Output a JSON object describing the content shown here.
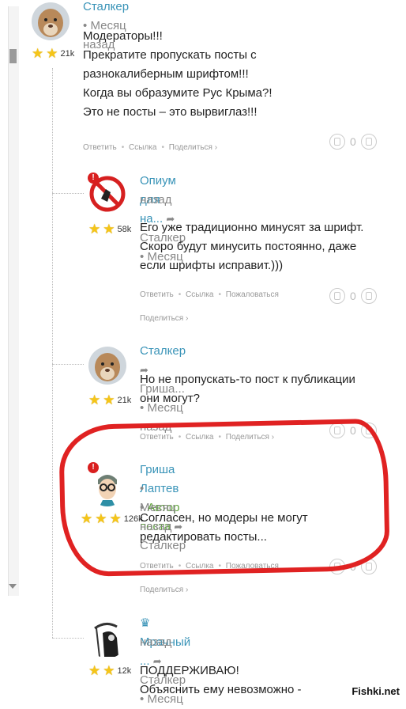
{
  "comments": [
    {
      "author": "Сталкер",
      "sep": "•",
      "time": "Месяц назад",
      "rank": "21k",
      "lines": [
        "Модераторы!!!",
        "Прекратите пропускать посты с",
        "разнокалиберным шрифтом!!!",
        "Когда вы образумите Рус Крыма?!",
        "Это не посты – это вырвиглаз!!!"
      ],
      "actions": [
        "Ответить",
        "Ссылка",
        "Поделиться ›"
      ],
      "score": "0"
    },
    {
      "author": "Опиум для на...",
      "reply_to": "Сталкер",
      "sep": "•",
      "time_line1": "Месяц",
      "time_line2": "назад",
      "rank": "58k",
      "lines": [
        "Его уже традиционно минусят за шрифт.",
        "Скоро будут минусить постоянно, даже",
        "если шрифты исправит.)))"
      ],
      "actions": [
        "Ответить",
        "Ссылка",
        "Пожаловаться"
      ],
      "actions2": "Поделиться ›",
      "score": "0"
    },
    {
      "author": "Сталкер",
      "reply_to": "Гриша...",
      "sep": "•",
      "time": "Месяц назад",
      "rank": "21k",
      "lines": [
        "Но не пропускать-то пост к публикации",
        "они могут?"
      ],
      "actions": [
        "Ответить",
        "Ссылка",
        "Поделиться ›"
      ],
      "score": "0"
    },
    {
      "author": "Гриша Лаптев",
      "tag": "Автор поста",
      "reply_to": "Сталкер",
      "sep": "•",
      "time": "Месяц назад",
      "rank": "126k",
      "lines": [
        "Согласен, но модеры не могут",
        "редактировать посты..."
      ],
      "actions": [
        "Ответить",
        "Ссылка",
        "Пожаловаться"
      ],
      "actions2": "Поделиться ›",
      "score": "0"
    },
    {
      "crown": "♛",
      "author": "Мрачный ...",
      "reply_to": "Сталкер",
      "sep": "•",
      "time_line1": "Месяц",
      "time_line2": "назад",
      "rank": "12k",
      "lines": [
        "ПОДДЕРЖИВАЮ!",
        "Объяснить ему невозможно -"
      ]
    }
  ],
  "alert_mark": "!",
  "watermark": "Fishki.net",
  "colors": {
    "author": "#3a94b8",
    "tag": "#5fa53b",
    "highlight": "#e02222"
  }
}
